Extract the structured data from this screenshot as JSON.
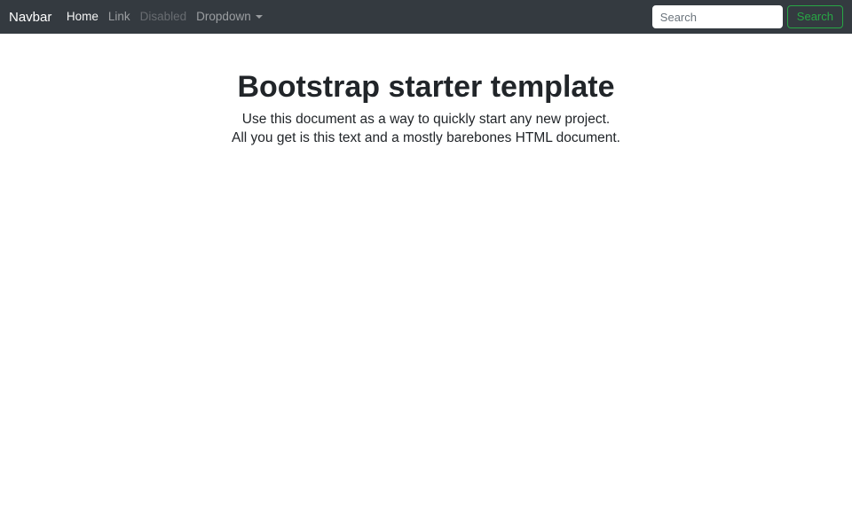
{
  "navbar": {
    "brand": "Navbar",
    "items": [
      {
        "label": "Home",
        "state": "active"
      },
      {
        "label": "Link",
        "state": "normal"
      },
      {
        "label": "Disabled",
        "state": "disabled"
      },
      {
        "label": "Dropdown",
        "state": "dropdown"
      }
    ],
    "search": {
      "placeholder": "Search",
      "button_label": "Search"
    },
    "colors": {
      "background": "#343a40",
      "success": "#28a745"
    }
  },
  "main": {
    "title": "Bootstrap starter template",
    "lead_line1": "Use this document as a way to quickly start any new project.",
    "lead_line2": "All you get is this text and a mostly barebones HTML document."
  }
}
